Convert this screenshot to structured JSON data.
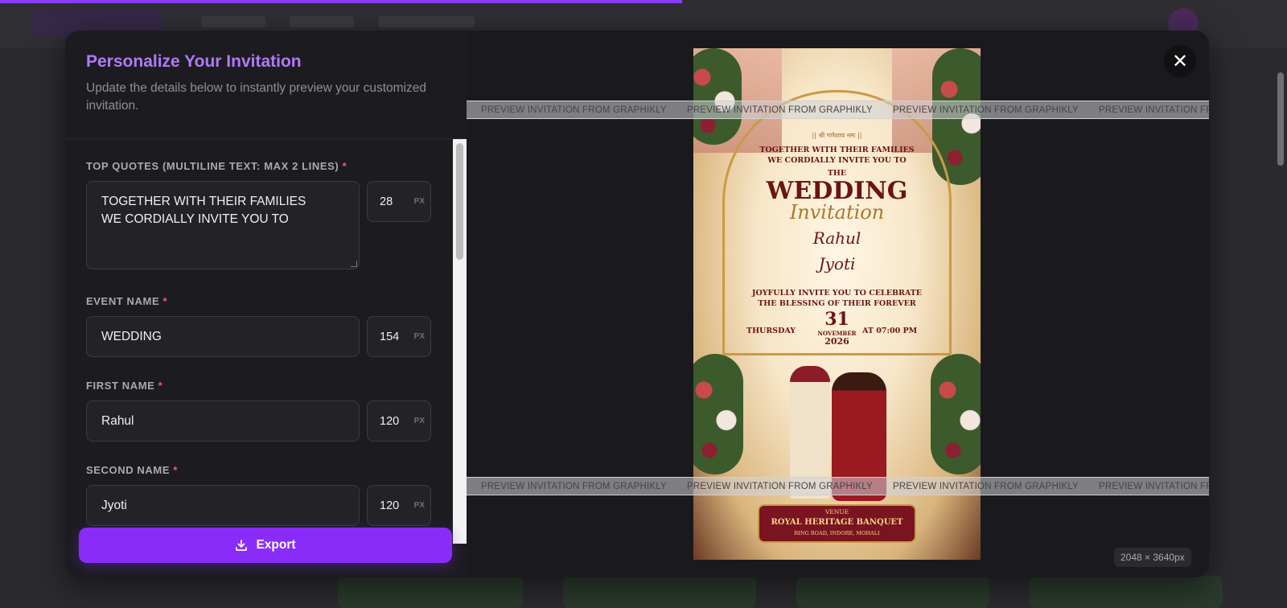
{
  "backdrop": {
    "progress_percent": 53
  },
  "panel": {
    "title": "Personalize Your Invitation",
    "subtitle": "Update the details below to instantly preview your customized invitation.",
    "fields": [
      {
        "label": "TOP QUOTES (MULTILINE TEXT: MAX 2 LINES)",
        "required": "*",
        "value": "TOGETHER WITH THEIR FAMILIES\nWE CORDIALLY INVITE YOU TO",
        "size": "28",
        "unit": "PX"
      },
      {
        "label": "EVENT NAME",
        "required": "*",
        "value": "WEDDING",
        "size": "154",
        "unit": "PX"
      },
      {
        "label": "FIRST NAME",
        "required": "*",
        "value": "Rahul",
        "size": "120",
        "unit": "PX"
      },
      {
        "label": "SECOND NAME",
        "required": "*",
        "value": "Jyoti",
        "size": "120",
        "unit": "PX"
      }
    ],
    "export_label": "Export"
  },
  "preview": {
    "watermark": "PREVIEW INVITATION FROM GRAPHIKLY",
    "close_label": "✕",
    "dimensions": "2048 × 3640px",
    "invitation": {
      "blessing": "|| श्री गणेशाय नमः ||",
      "line1": "TOGETHER WITH THEIR FAMILIES",
      "line2": "WE CORDIALLY INVITE YOU TO",
      "the": "THE",
      "event": "WEDDING",
      "subtitle": "Invitation",
      "first_name": "Rahul",
      "second_name": "Jyoti",
      "celebrate1": "JOYFULLY INVITE YOU TO CELEBRATE",
      "celebrate2": "THE BLESSING OF THEIR FOREVER",
      "day": "THURSDAY",
      "date": "31",
      "month": "NOVEMBER",
      "year": "2026",
      "time": "AT 07:00 PM",
      "venue_label": "VENUE",
      "venue_name": "ROYAL HERITAGE BANQUET",
      "venue_address": "RING ROAD, INDORE, MOHALI"
    }
  }
}
